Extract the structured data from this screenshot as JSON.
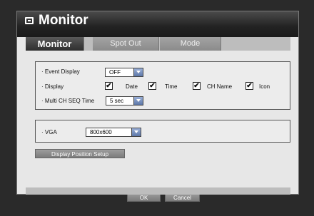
{
  "window": {
    "title": "Monitor",
    "icon": "monitor-icon"
  },
  "tabs": [
    {
      "label": "Monitor",
      "active": true
    },
    {
      "label": "Spot Out",
      "active": false
    },
    {
      "label": "Mode",
      "active": false
    }
  ],
  "display_group": {
    "event_display": {
      "label": "· Event Display",
      "value": "OFF"
    },
    "display": {
      "label": "· Display",
      "options": [
        {
          "label": "Date",
          "checked": true
        },
        {
          "label": "Time",
          "checked": true
        },
        {
          "label": "CH Name",
          "checked": true
        },
        {
          "label": "Icon",
          "checked": true
        }
      ]
    },
    "multi_ch_seq": {
      "label": "· Multi CH SEQ Time",
      "value": "5 sec"
    }
  },
  "vga_group": {
    "label": "· VGA",
    "value": "800x600"
  },
  "buttons": {
    "display_position": "Display Position Setup",
    "ok": "OK",
    "cancel": "Cancel"
  },
  "check_mark": "✔",
  "colors": {
    "active_tab": "#3a3a3a",
    "inactive_tab": "#8b8b8b",
    "combo_arrow": "#5d77a8"
  }
}
